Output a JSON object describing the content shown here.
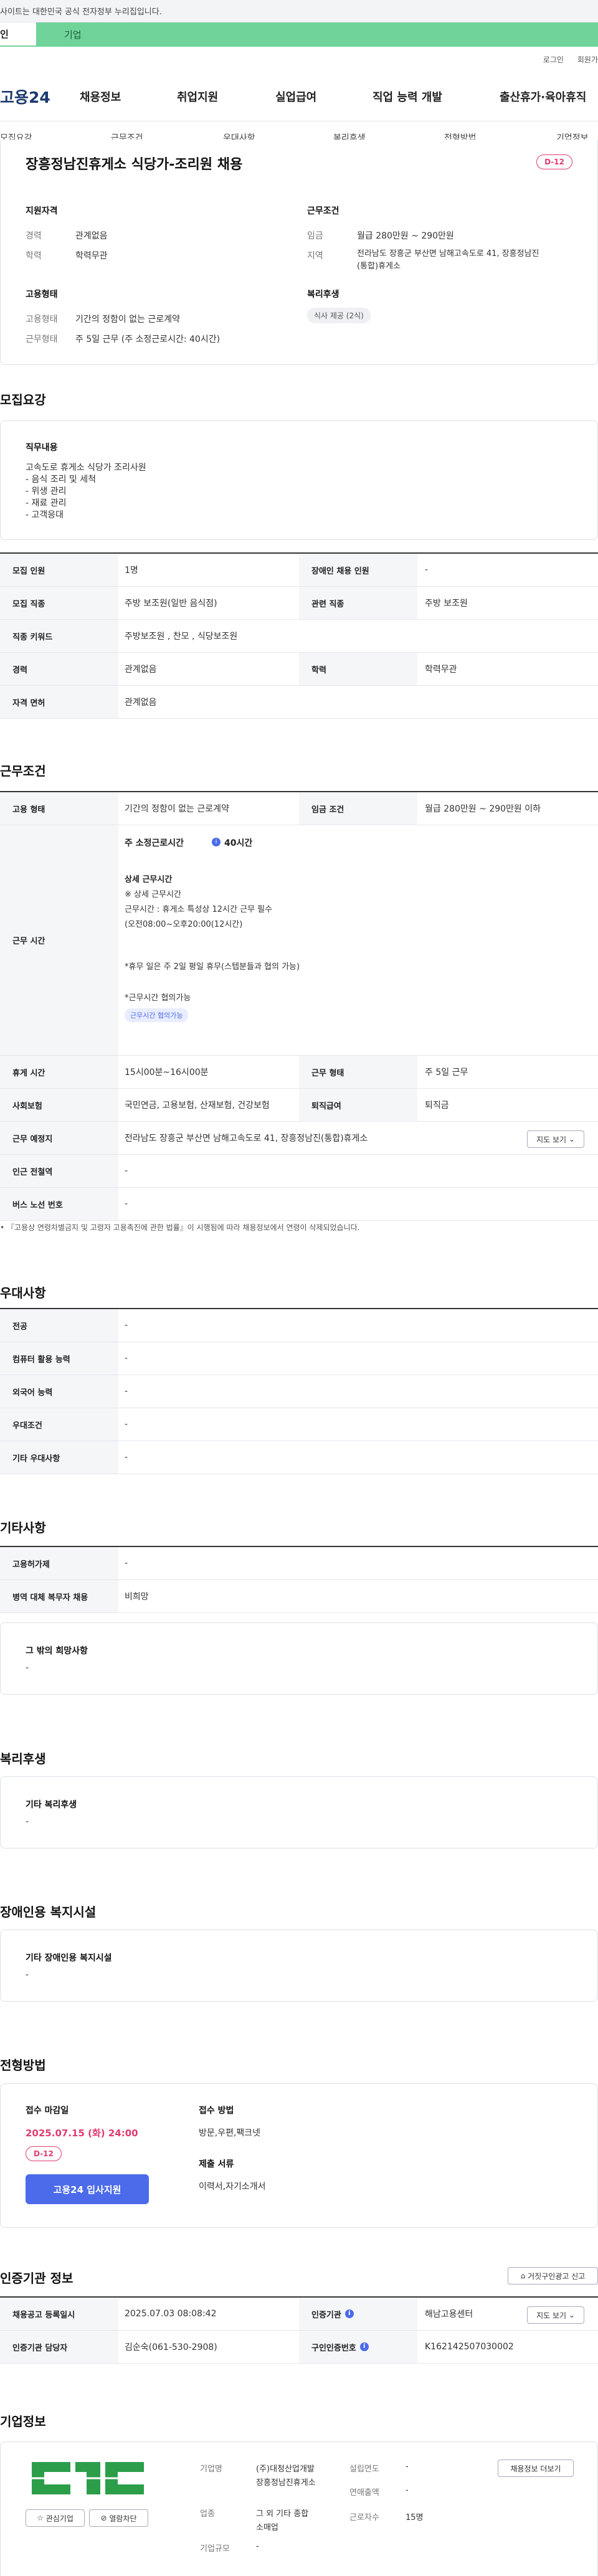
{
  "gov_banner": {
    "text": "사이트는 대한민국 공식 전자정부 누리집입니다."
  },
  "top_tabs": [
    {
      "label": "인"
    },
    {
      "label": "기업"
    }
  ],
  "util": [
    {
      "label": "로그인"
    },
    {
      "label": "회원가"
    }
  ],
  "logo": "고용24",
  "gnb": [
    {
      "label": "채용정보"
    },
    {
      "label": "취업지원"
    },
    {
      "label": "실업급여"
    },
    {
      "label": "직업 능력 개발"
    },
    {
      "label": "출산휴가·육아휴직"
    }
  ],
  "snb": [
    {
      "label": "모집요강"
    },
    {
      "label": "근무조건"
    },
    {
      "label": "우대사항"
    },
    {
      "label": "복리후생"
    },
    {
      "label": "전형방법"
    },
    {
      "label": "기업정보"
    }
  ],
  "summary": {
    "title": "장흥정남진휴게소 식당가-조리원 채용",
    "dday": "D-12",
    "qual_title": "지원자격",
    "qual": [
      {
        "k": "경력",
        "v": "관계없음"
      },
      {
        "k": "학력",
        "v": "학력무관"
      }
    ],
    "work_title": "근무조건",
    "wage_k": "임금",
    "wage_v": "월급 280만원 ~ 290만원",
    "area_k": "지역",
    "area_v1": "전라남도 장흥군 부산면 남해고속도로 41, 장흥정남진",
    "area_v2": "(통합)휴게소",
    "emp_title": "고용형태",
    "emp": [
      {
        "k": "고용형태",
        "v": "기간의 정함이 없는 근로계약"
      },
      {
        "k": "근무형태",
        "v": "주 5일 근무 (주 소정근로시간: 40시간)"
      }
    ],
    "welfare_title": "복리후생",
    "welfare_badge": "식사 제공 (2식)"
  },
  "recruit": {
    "title": "모집요강",
    "duty_title": "직무내용",
    "duty_lines": [
      "고속도로 휴게소 식당가 조리사원",
      "- 음식 조리 및 세척",
      "- 위생 관리",
      "- 재료 관리",
      "- 고객응대"
    ],
    "rows": [
      {
        "k1": "모집 인원",
        "v1": "1명",
        "k2": "장애인 채용 인원",
        "v2": "-"
      },
      {
        "k1": "모집 직종",
        "v1": "주방 보조원(일반 음식점)",
        "k2": "관련 직종",
        "v2": "주방 보조원"
      },
      {
        "k1": "직종 키워드",
        "v1": "주방보조원 , 찬모 , 식당보조원"
      },
      {
        "k1": "경력",
        "v1": "관계없음",
        "k2": "학력",
        "v2": "학력무관"
      },
      {
        "k1": "자격 면허",
        "v1": "관계없음"
      }
    ]
  },
  "conditions": {
    "title": "근무조건",
    "emp_k": "고용 형태",
    "emp_v": "기간의 정함이 없는 근로계약",
    "wage_k": "임금 조건",
    "wage_v": "월급 280만원 ~ 290만원 이하",
    "time_k": "근무 시간",
    "hours_label": "주 소정근로시간",
    "hours_value": "40시간",
    "detail_title": "상세 근무시간",
    "detail_lines": [
      "※ 상세 근무시간",
      "근무시간 : 휴게소 특성상 12시간 근무 필수",
      "(오전08:00~오후20:00(12시간)",
      "",
      "*휴무 일은 주 2일 평일 휴무(스텝분들과 협의 가능)",
      "",
      "*근무시간 협의가능"
    ],
    "time_badge": "근무시간 협의가능",
    "break_k": "휴게 시간",
    "break_v": "15시00분~16시00분",
    "shift_k": "근무 형태",
    "shift_v": "주 5일 근무",
    "ins_k": "사회보험",
    "ins_v": "국민연금, 고용보험, 산재보험, 건강보험",
    "sev_k": "퇴직급여",
    "sev_v": "퇴직금",
    "place_k": "근무 예정지",
    "place_v": "전라남도 장흥군 부산면 남해고속도로 41, 장흥정남진(통합)휴게소",
    "map_btn": "지도 보기",
    "subway_k": "인근 전철역",
    "subway_v": "-",
    "bus_k": "버스 노선 번호",
    "bus_v": "-",
    "note": "『고용상 연령차별금지 및 고령자 고용촉진에 관한 법률』이 시행됨에 따라 채용정보에서 연령이 삭제되었습니다."
  },
  "preference": {
    "title": "우대사항",
    "rows": [
      {
        "k": "전공",
        "v": "-"
      },
      {
        "k": "컴퓨터 활용 능력",
        "v": "-"
      },
      {
        "k": "외국어 능력",
        "v": "-"
      },
      {
        "k": "우대조건",
        "v": "-"
      },
      {
        "k": "기타 우대사항",
        "v": "-"
      }
    ]
  },
  "etc": {
    "title": "기타사항",
    "rows": [
      {
        "k": "고용허가제",
        "v": "-"
      },
      {
        "k": "병역 대체 복무자 채용",
        "v": "비희망"
      }
    ],
    "box_title": "그 밖의 희망사항",
    "box_value": "-"
  },
  "welfare": {
    "title": "복리후생",
    "box_title": "기타 복리후생",
    "box_value": "-"
  },
  "disability": {
    "title": "장애인용 복지시설",
    "box_title": "기타 장애인용 복지시설",
    "box_value": "-"
  },
  "process": {
    "title": "전형방법",
    "deadline_title": "접수 마감일",
    "deadline": "2025.07.15 (화) 24:00",
    "dday": "D-12",
    "apply_btn": "고용24 입사지원",
    "method_title": "접수 방법",
    "method": "방문,우편,팩크넷",
    "docs_title": "제출 서류",
    "docs": "이력서,자기소개서"
  },
  "cert": {
    "title": "인증기관 정보",
    "report_btn": "거짓구인광고 신고",
    "rows": [
      {
        "k1": "채용공고 등록일시",
        "v1": "2025.07.03 08:08:42",
        "k2": "인증기관",
        "v2": "해남고용센터",
        "btn": "지도 보기"
      },
      {
        "k1": "인증기관 담당자",
        "v1": "김순숙(061-530-2908)",
        "k2": "구인인증번호",
        "v2": "K162142507030002"
      }
    ]
  },
  "company": {
    "title": "기업정보",
    "fav_btn": "관심기업",
    "block_btn": "열람차단",
    "name_k": "기업명",
    "name_v1": "(주)대청산업개발",
    "name_v2": "장흥정남진휴게소",
    "found_k": "설립연도",
    "found_v": "-",
    "jobs_btn": "채용정보 더보기",
    "sales_k": "연매출액",
    "sales_v": "-",
    "industry_k": "업종",
    "industry_v1": "그 외 기타 종합",
    "industry_v2": "소매업",
    "staff_k": "근로자수",
    "staff_v": "15명",
    "size_k": "기업규모",
    "size_v": "-"
  }
}
